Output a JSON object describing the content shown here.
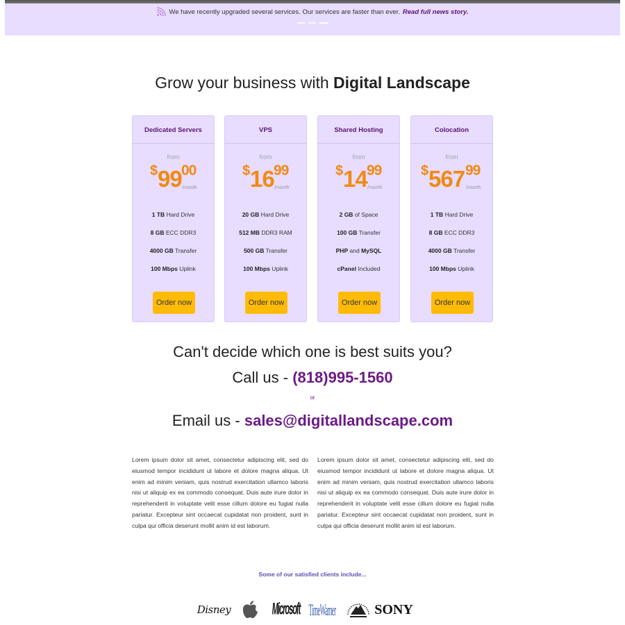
{
  "announcement": {
    "text": "We have recently upgraded several services. Our services are faster than ever.",
    "link": "Read full news story.",
    "icon": "rss-icon",
    "slide_count": 3,
    "active_slide": 3
  },
  "headline": {
    "prefix": "Grow your business with",
    "brand": "Digital Landscape"
  },
  "plans": [
    {
      "name": "Dedicated Servers",
      "from": "from",
      "currency": "$",
      "price_main": "99",
      "price_cents": "00",
      "period": "/month",
      "features": [
        {
          "bold": "1 TB",
          "rest": "Hard Drive"
        },
        {
          "bold": "8 GB",
          "rest": "ECC DDR3"
        },
        {
          "bold": "4000 GB",
          "rest": "Transfer"
        },
        {
          "bold": "100 Mbps",
          "rest": "Uplink"
        }
      ],
      "button": "Order now"
    },
    {
      "name": "VPS",
      "from": "from",
      "currency": "$",
      "price_main": "16",
      "price_cents": "99",
      "period": "/month",
      "features": [
        {
          "bold": "20 GB",
          "rest": "Hard Drive"
        },
        {
          "bold": "512 MB",
          "rest": "DDR3 RAM"
        },
        {
          "bold": "500 GB",
          "rest": "Transfer"
        },
        {
          "bold": "100 Mbps",
          "rest": "Uplink"
        }
      ],
      "button": "Order now"
    },
    {
      "name": "Shared Hosting",
      "from": "from",
      "currency": "$",
      "price_main": "14",
      "price_cents": "99",
      "period": "/month",
      "features": [
        {
          "bold": "2 GB",
          "rest": "of Space"
        },
        {
          "bold": "100 GB",
          "rest": "Transfer"
        },
        {
          "bold": "PHP",
          "rest": "and",
          "bold2": "MySQL"
        },
        {
          "bold": "cPanel",
          "rest": "Included"
        }
      ],
      "button": "Order now"
    },
    {
      "name": "Colocation",
      "from": "from",
      "currency": "$",
      "price_main": "567",
      "price_cents": "99",
      "period": "/month",
      "features": [
        {
          "bold": "1 TB",
          "rest": "Hard Drive"
        },
        {
          "bold": "8 GB",
          "rest": "ECC DDR3"
        },
        {
          "bold": "4000 GB",
          "rest": "Transfer"
        },
        {
          "bold": "100 Mbps",
          "rest": "Uplink"
        }
      ],
      "button": "Order now"
    }
  ],
  "contact": {
    "question": "Can't decide which one is best suits you?",
    "call_prefix": "Call us -",
    "phone": "(818)995-1560",
    "or": "or",
    "email_prefix": "Email us -",
    "email": "sales@digitallandscape.com"
  },
  "lorem": [
    "Lorem ipsum dolor sit amet, consectetur adipiscing elit, sed do eiusmod tempor incididunt ut labore et dolore magna aliqua. Ut enim ad minim veniam, quis nostrud exercitation ullamco laboris nisi ut aliquip ex ea commodo consequat. Duis aute irure dolor in reprehenderit in voluptate velit esse cillum dolore eu fugiat nulla pariatur. Excepteur sint occaecat cupidatat non proident, sunt in culpa qui officia deserunt mollit anim id est laborum.",
    "Lorem ipsum dolor sit amet, consectetur adipiscing elit, sed do eiusmod tempor incididunt ut labore et dolore magna aliqua. Ut enim ad minim veniam, quis nostrud exercitation ullamco laboris nisi ut aliquip ex ea commodo consequat. Duis aute irure dolor in reprehenderit in voluptate velit esse cillum dolore eu fugiat nulla pariatur. Excepteur sint occaecat cupidatat non proident, sunt in culpa qui officia deserunt mollit anim id est laborum."
  ],
  "clients": {
    "title": "Some of our satisfied clients include...",
    "logos": [
      {
        "name": "disney-logo",
        "text": "Disney"
      },
      {
        "name": "apple-logo",
        "text": ""
      },
      {
        "name": "microsoft-logo",
        "text": "Microsoft"
      },
      {
        "name": "timewarner-logo",
        "text": "TimeWarner"
      },
      {
        "name": "paramount-logo",
        "text": ""
      },
      {
        "name": "sony-logo",
        "text": "SONY"
      }
    ]
  },
  "colors": {
    "accent_purple": "#6b1a86",
    "card_bg": "#e8dcff",
    "price_orange": "#f08a14",
    "button_yellow": "#ffbb08"
  }
}
